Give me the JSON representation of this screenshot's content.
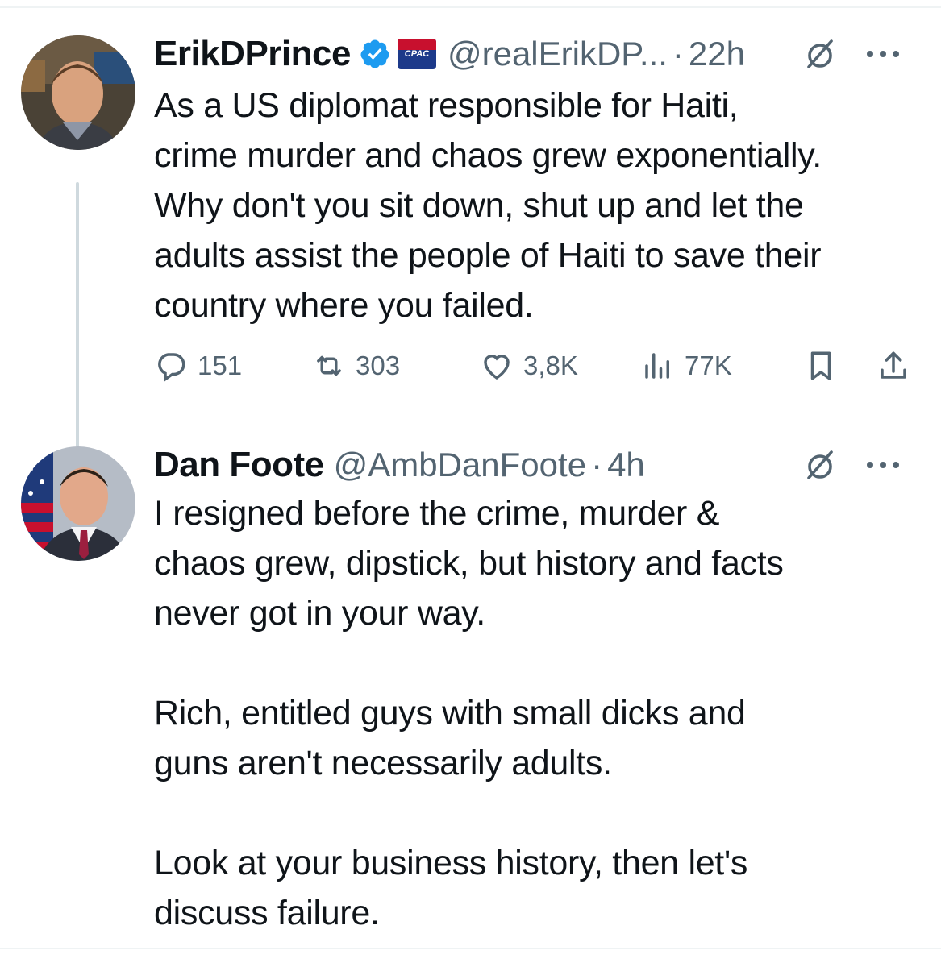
{
  "tweets": [
    {
      "author": {
        "name": "ErikDPrince",
        "handle": "@realErikDP...",
        "verified": true,
        "affiliate_badge_text": "CPAC"
      },
      "time": "22h",
      "separator": "·",
      "text": "As a US diplomat responsible for Haiti,\ncrime murder and chaos grew exponentially.\nWhy don't you sit down, shut up and let the\nadults assist the people of Haiti to save their\ncountry where you failed.",
      "metrics": {
        "replies": "151",
        "reposts": "303",
        "likes": "3,8K",
        "views": "77K"
      }
    },
    {
      "author": {
        "name": "Dan Foote",
        "handle": "@AmbDanFoote"
      },
      "time": "4h",
      "separator": "·",
      "text": "I resigned before the crime, murder &\nchaos grew, dipstick, but history and facts\nnever got in your way.\n\nRich, entitled guys with small dicks and\nguns aren't necessarily adults.\n\nLook at your business history, then let's\ndiscuss failure."
    }
  ],
  "icons": {
    "verified": "verified-badge-icon",
    "grok": "grok-icon",
    "more": "more-icon",
    "reply": "reply-icon",
    "repost": "repost-icon",
    "like": "heart-icon",
    "views": "views-icon",
    "bookmark": "bookmark-icon",
    "share": "share-icon"
  },
  "colors": {
    "text": "#0f1419",
    "secondary": "#536471",
    "verified": "#1d9bf0",
    "border": "#eff3f4",
    "thread_line": "#cfd9de"
  }
}
